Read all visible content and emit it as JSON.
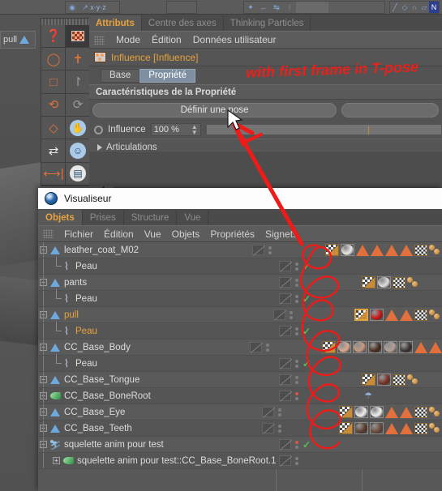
{
  "app": {
    "attributes_panel": {
      "tabs": [
        {
          "label": "Attributs",
          "active": true
        },
        {
          "label": "Centre des axes",
          "active": false
        },
        {
          "label": "Thinking Particles",
          "active": false
        }
      ],
      "menu": [
        "Mode",
        "Édition",
        "Données utilisateur"
      ],
      "object_name": "Influence [Influence]",
      "object_icon": "influence-tag-icon",
      "subtabs": [
        {
          "label": "Base",
          "selected": false
        },
        {
          "label": "Propriété",
          "selected": true
        }
      ],
      "section_title": "Caractéristiques de la Propriété",
      "set_pose_button": "Définir une pose",
      "secondary_button": "",
      "influence": {
        "label": "Influence",
        "value": "100 %",
        "radio_on": false
      },
      "joints_section": "Articulations"
    },
    "visualiseur": {
      "title": "Visualiseur",
      "title_icon": "cinema4d-orb-icon",
      "tabs": [
        {
          "label": "Objets",
          "active": true
        },
        {
          "label": "Prises",
          "active": false
        },
        {
          "label": "Structure",
          "active": false
        },
        {
          "label": "Vue",
          "active": false
        }
      ],
      "menu": [
        "Fichier",
        "Édition",
        "Vue",
        "Objets",
        "Propriétés",
        "Signets"
      ],
      "tree": [
        {
          "name": "leather_coat_M02",
          "icon": "polygon-object-icon",
          "depth": 0,
          "expander": "minus",
          "highlight": false,
          "tags": [
            {
              "type": "weight",
              "selected": false
            },
            {
              "type": "material",
              "color": "#e8e8e8",
              "shade": "dark-half"
            },
            {
              "type": "triangle"
            },
            {
              "type": "triangle"
            },
            {
              "type": "triangle"
            },
            {
              "type": "triangle"
            },
            {
              "type": "checker"
            },
            {
              "type": "balls"
            }
          ],
          "layer": true,
          "dots": "normal",
          "check": false
        },
        {
          "name": "Peau",
          "icon": "skin-deformer-icon",
          "depth": 1,
          "expander": "none",
          "highlight": false,
          "tags": [],
          "layer": true,
          "dots": "normal",
          "check": true
        },
        {
          "name": "pants",
          "icon": "polygon-object-icon",
          "depth": 0,
          "expander": "minus",
          "highlight": false,
          "tags": [
            {
              "type": "weight",
              "selected": false
            },
            {
              "type": "material",
              "color": "#dedede",
              "shade": "white"
            },
            {
              "type": "checker"
            },
            {
              "type": "balls"
            }
          ],
          "layer": true,
          "dots": "normal",
          "check": false
        },
        {
          "name": "Peau",
          "icon": "skin-deformer-icon",
          "depth": 1,
          "expander": "none",
          "highlight": false,
          "tags": [],
          "layer": true,
          "dots": "normal",
          "check": true
        },
        {
          "name": "pull",
          "icon": "polygon-object-icon",
          "depth": 0,
          "expander": "minus",
          "highlight": true,
          "tags": [
            {
              "type": "weight",
              "selected": true
            },
            {
              "type": "material",
              "color": "#cc1414",
              "shade": "red"
            },
            {
              "type": "triangle"
            },
            {
              "type": "triangle"
            },
            {
              "type": "checker"
            },
            {
              "type": "balls"
            }
          ],
          "layer": true,
          "dots": "normal",
          "check": false
        },
        {
          "name": "Peau",
          "icon": "skin-deformer-icon",
          "depth": 1,
          "expander": "none",
          "highlight": true,
          "tags": [],
          "layer": true,
          "dots": "normal",
          "check": true
        },
        {
          "name": "CC_Base_Body",
          "icon": "polygon-object-icon",
          "depth": 0,
          "expander": "minus",
          "highlight": false,
          "tags": [
            {
              "type": "weight",
              "selected": false
            },
            {
              "type": "material",
              "color": "#d9a98f",
              "shade": "skin"
            },
            {
              "type": "material",
              "color": "#c79a80",
              "shade": "skin2"
            },
            {
              "type": "material",
              "color": "#4a2c1e",
              "shade": "brown"
            },
            {
              "type": "material",
              "color": "#b3a096",
              "shade": "patterned"
            },
            {
              "type": "material",
              "color": "#3a3330",
              "shade": "dark-pattern"
            },
            {
              "type": "triangle"
            },
            {
              "type": "triangle"
            }
          ],
          "layer": true,
          "dots": "normal",
          "check": false
        },
        {
          "name": "Peau",
          "icon": "skin-deformer-icon",
          "depth": 1,
          "expander": "none",
          "highlight": false,
          "tags": [],
          "layer": true,
          "dots": "normal",
          "check": true
        },
        {
          "name": "CC_Base_Tongue",
          "icon": "polygon-object-icon",
          "depth": 0,
          "expander": "plus",
          "highlight": false,
          "tags": [
            {
              "type": "weight",
              "selected": false
            },
            {
              "type": "material",
              "color": "#7d2f24",
              "shade": "tongue"
            },
            {
              "type": "checker"
            },
            {
              "type": "balls"
            }
          ],
          "layer": true,
          "dots": "normal",
          "check": false
        },
        {
          "name": "CC_Base_BoneRoot",
          "icon": "bone-root-icon",
          "depth": 0,
          "expander": "plus",
          "highlight": false,
          "tags": [
            {
              "type": "pose"
            }
          ],
          "layer": true,
          "dots": "red",
          "check": false
        },
        {
          "name": "CC_Base_Eye",
          "icon": "polygon-object-icon",
          "depth": 0,
          "expander": "plus",
          "highlight": false,
          "tags": [
            {
              "type": "weight",
              "selected": false
            },
            {
              "type": "material",
              "color": "#f0efee",
              "shade": "eye"
            },
            {
              "type": "material",
              "color": "#f2f1f0",
              "shade": "eye2"
            },
            {
              "type": "triangle"
            },
            {
              "type": "triangle"
            },
            {
              "type": "checker"
            },
            {
              "type": "balls"
            }
          ],
          "layer": true,
          "dots": "normal",
          "check": false
        },
        {
          "name": "CC_Base_Teeth",
          "icon": "polygon-object-icon",
          "depth": 0,
          "expander": "plus",
          "highlight": false,
          "tags": [
            {
              "type": "weight",
              "selected": false
            },
            {
              "type": "material",
              "color": "#5b3a2a",
              "shade": "teeth"
            },
            {
              "type": "material",
              "color": "#6b4a38",
              "shade": "teeth2"
            },
            {
              "type": "triangle"
            },
            {
              "type": "triangle"
            },
            {
              "type": "checker"
            },
            {
              "type": "balls"
            }
          ],
          "layer": true,
          "dots": "normal",
          "check": false
        },
        {
          "name": "squelette anim pour test",
          "icon": "character-object-icon",
          "depth": 0,
          "expander": "minus",
          "highlight": false,
          "tags": [],
          "layer": true,
          "dots": "red",
          "check": true
        },
        {
          "name": "squelette anim pour test::CC_Base_BoneRoot.1",
          "icon": "bone-root-icon",
          "depth": 1,
          "expander": "plus",
          "highlight": false,
          "tags": [],
          "layer": true,
          "dots": "normal",
          "check": false
        }
      ]
    },
    "scene_chip": {
      "label": "pull",
      "icon": "polygon-object-icon"
    },
    "toolbar_left": {
      "column_a": [
        "help-cursor-icon",
        "live-selection-icon",
        "rectangle-selection-icon",
        "lasso-selection-icon",
        "polygon-selection-icon",
        "move-transfer-icon",
        "mirror-icon"
      ],
      "column_b": [
        "render-preview-icon",
        "paint-brush-icon",
        "bend-tool-icon",
        "deform-tool-icon",
        "character-figure-icon",
        "walk-cycle-icon",
        "weight-paint-icon"
      ]
    },
    "annotations": {
      "note": "with first frame in T-pose",
      "note_color": "#e8211b",
      "arrow_color": "#ee1b18",
      "circle_color": "#ee1b18"
    }
  }
}
